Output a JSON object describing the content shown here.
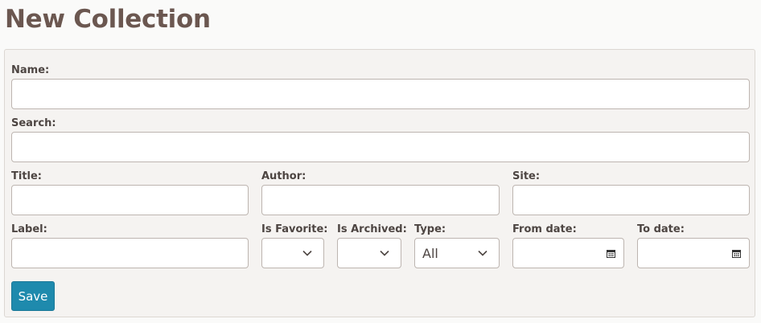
{
  "page": {
    "title": "New Collection"
  },
  "form": {
    "name": {
      "label": "Name:",
      "value": ""
    },
    "search": {
      "label": "Search:",
      "value": ""
    },
    "title": {
      "label": "Title:",
      "value": ""
    },
    "author": {
      "label": "Author:",
      "value": ""
    },
    "site": {
      "label": "Site:",
      "value": ""
    },
    "label_field": {
      "label": "Label:",
      "value": ""
    },
    "is_favorite": {
      "label": "Is Favorite:",
      "selected": ""
    },
    "is_archived": {
      "label": "Is Archived:",
      "selected": ""
    },
    "type": {
      "label": "Type:",
      "selected": "All"
    },
    "from_date": {
      "label": "From date:",
      "value": ""
    },
    "to_date": {
      "label": "To date:",
      "value": ""
    },
    "save_label": "Save"
  },
  "icons": {
    "dropdown": "chevron-down-icon",
    "date": "calendar-icon"
  },
  "colors": {
    "title": "#6b5750",
    "primary_button": "#1e8aad",
    "panel_bg": "#f5f3f1"
  }
}
